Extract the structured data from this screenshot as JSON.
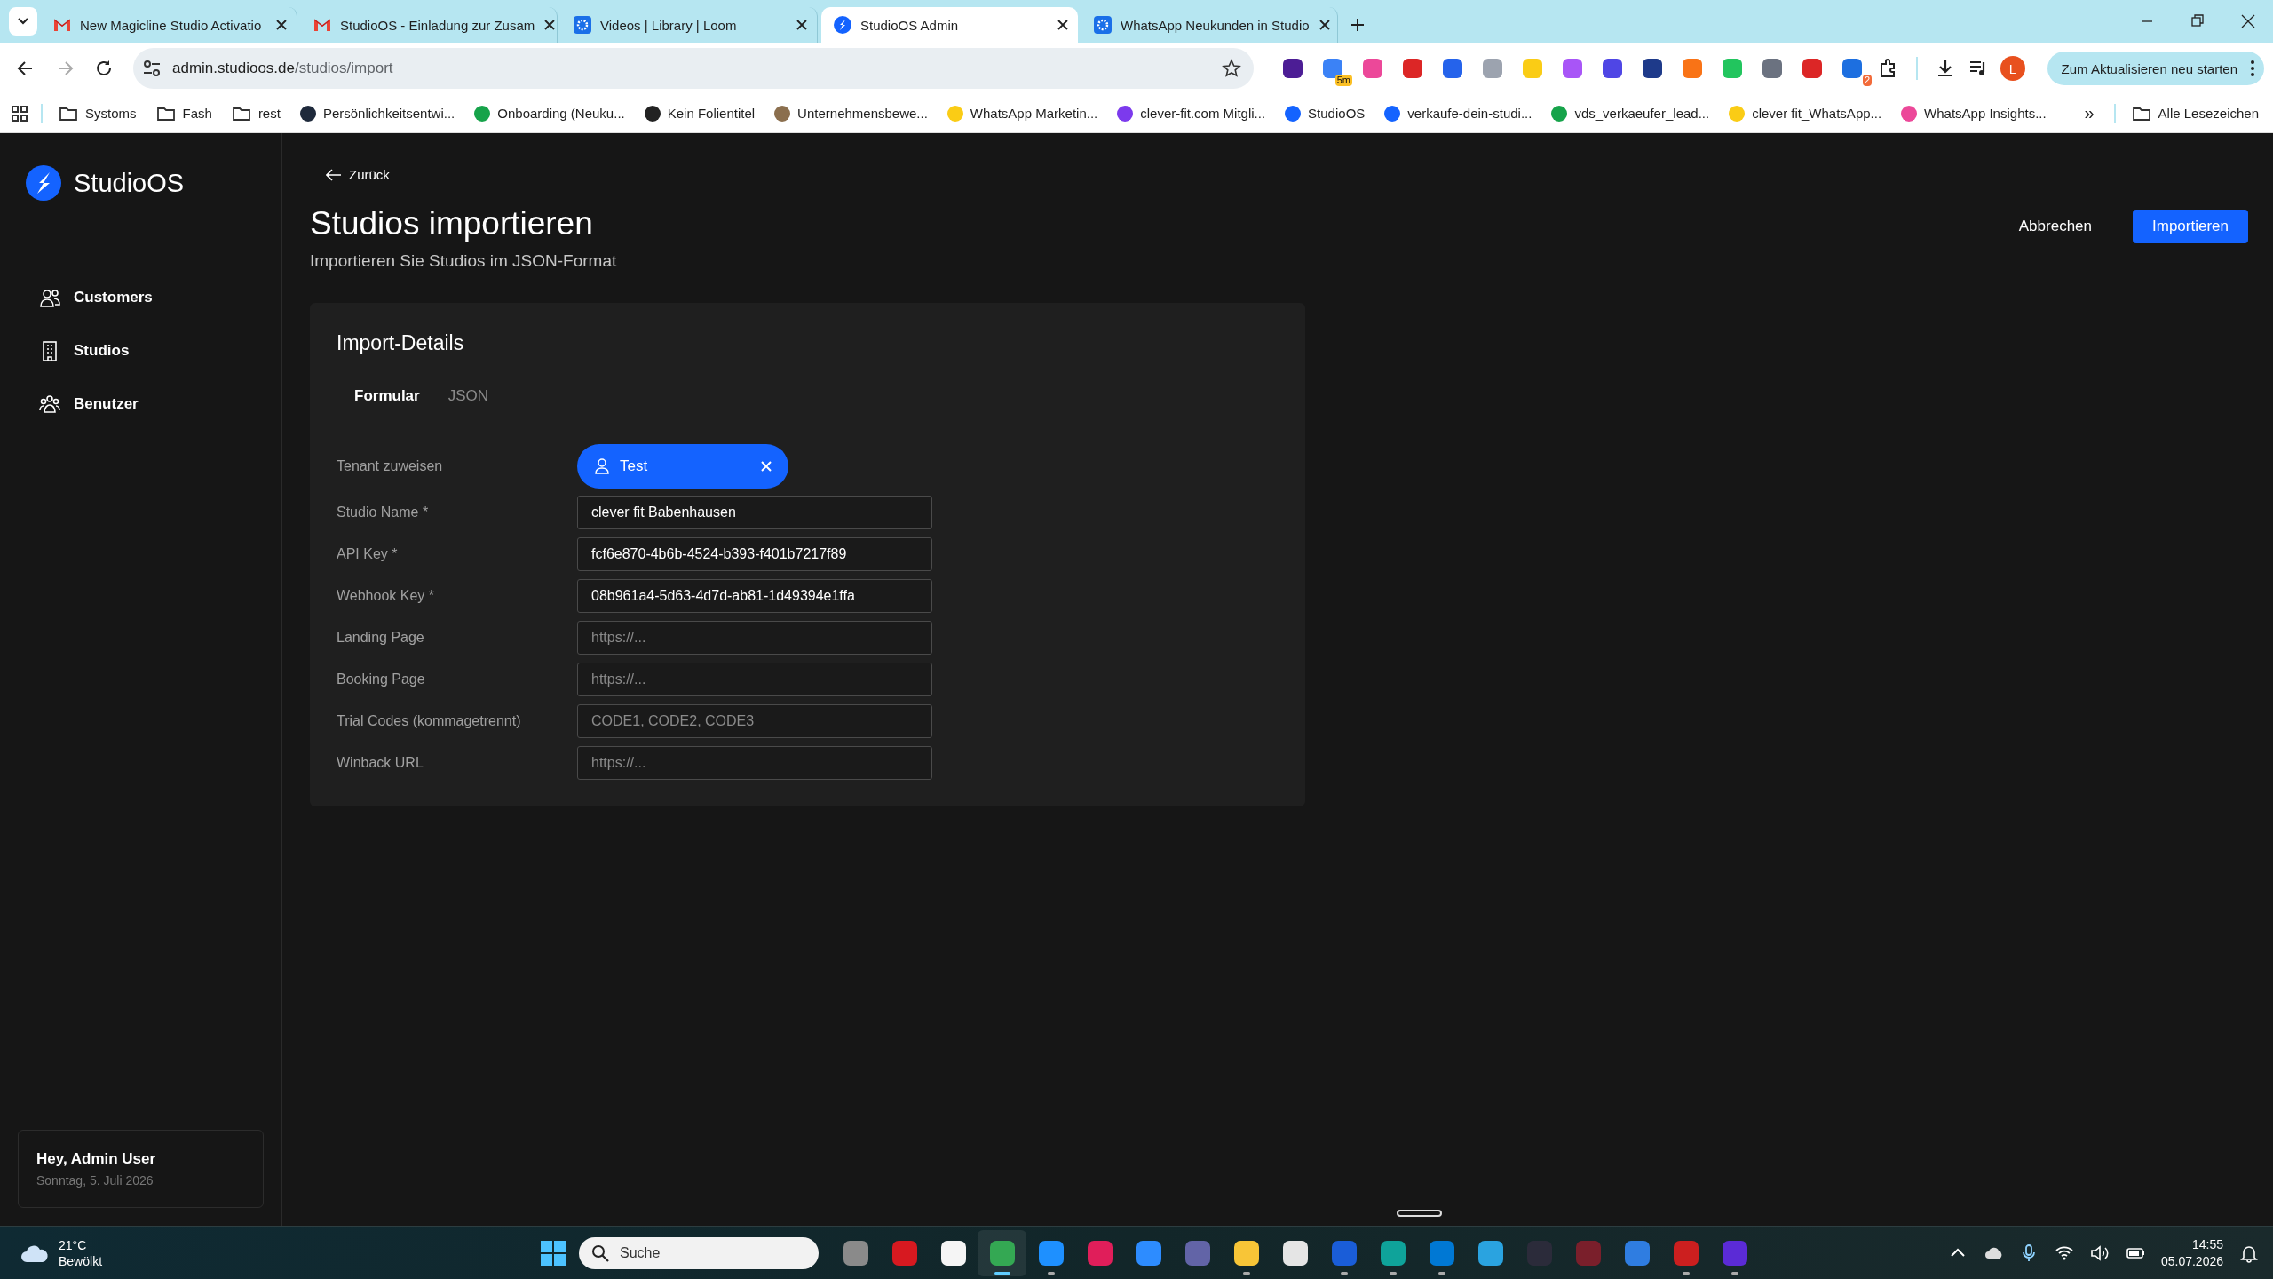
{
  "browser": {
    "tabs": [
      {
        "title": "New Magicline Studio Activatio",
        "kind": "mail",
        "selected": false
      },
      {
        "title": "StudioOS - Einladung zur Zusam",
        "kind": "mail",
        "selected": false
      },
      {
        "title": "Videos | Library | Loom",
        "kind": "gear",
        "selected": false
      },
      {
        "title": "StudioOS Admin",
        "kind": "compass",
        "selected": true
      },
      {
        "title": "WhatsApp Neukunden in Studio",
        "kind": "gear",
        "selected": false
      }
    ],
    "address": {
      "host": "admin.studioos.de",
      "path": "/studios/import"
    },
    "extensions": [
      {
        "color": "#4c1d95"
      },
      {
        "color": "#3b82f6",
        "badge": "5m"
      },
      {
        "color": "#ec4899"
      },
      {
        "color": "#dc2626"
      },
      {
        "color": "#2563eb"
      },
      {
        "color": "#9ca3af"
      },
      {
        "color": "#facc15"
      },
      {
        "color": "#a855f7"
      },
      {
        "color": "#4f46e5"
      },
      {
        "color": "#1e3a8a"
      },
      {
        "color": "#f97316"
      },
      {
        "color": "#22c55e"
      },
      {
        "color": "#6b7280"
      },
      {
        "color": "#dc2626"
      },
      {
        "color": "#1d6fe0",
        "badge": "2"
      }
    ],
    "profile": "L",
    "update_button": "Zum Aktualisieren neu starten",
    "bookmarks": [
      {
        "label": "Systoms",
        "kind": "folder"
      },
      {
        "label": "Fash",
        "kind": "folder"
      },
      {
        "label": "rest",
        "kind": "folder"
      },
      {
        "label": "Persönlichkeitsentwi...",
        "kind": "site",
        "color": "#1e293b"
      },
      {
        "label": "Onboarding (Neuku...",
        "kind": "site",
        "color": "#16a34a"
      },
      {
        "label": "Kein Folientitel",
        "kind": "site",
        "color": "#222222"
      },
      {
        "label": "Unternehmensbewe...",
        "kind": "site",
        "color": "#8b6f4e"
      },
      {
        "label": "WhatsApp Marketin...",
        "kind": "site",
        "color": "#facc15"
      },
      {
        "label": "clever-fit.com Mitgli...",
        "kind": "site",
        "color": "#7c3aed"
      },
      {
        "label": "StudioOS",
        "kind": "site",
        "color": "#1463ff"
      },
      {
        "label": "verkaufe-dein-studi...",
        "kind": "site",
        "color": "#1463ff"
      },
      {
        "label": "vds_verkaeufer_lead...",
        "kind": "site",
        "color": "#16a34a"
      },
      {
        "label": "clever fit_WhatsApp...",
        "kind": "site",
        "color": "#facc15"
      },
      {
        "label": "WhatsApp Insights...",
        "kind": "site",
        "color": "#ec4899"
      }
    ],
    "more_bookmarks": "»",
    "all_bookmarks": "Alle Lesezeichen"
  },
  "app": {
    "brand": "StudioOS",
    "nav": [
      {
        "label": "Customers",
        "kind": "users"
      },
      {
        "label": "Studios",
        "kind": "building"
      },
      {
        "label": "Benutzer",
        "kind": "group"
      }
    ],
    "user": {
      "greeting": "Hey, Admin User",
      "date": "Sonntag, 5. Juli 2026"
    },
    "back": "Zurück",
    "title": "Studios importieren",
    "subtitle": "Importieren Sie Studios im JSON-Format",
    "actions": [
      {
        "label": "Abbrechen",
        "kind": "secondary"
      },
      {
        "label": "Importieren",
        "kind": "primary"
      }
    ],
    "card": {
      "title": "Import-Details",
      "tabs": [
        {
          "label": "Formular",
          "selected": true
        },
        {
          "label": "JSON",
          "selected": false
        }
      ],
      "fields": [
        {
          "kind": "tenant",
          "label": "Tenant zuweisen",
          "value": "Test"
        },
        {
          "kind": "input",
          "label": "Studio Name *",
          "value": "clever fit Babenhausen"
        },
        {
          "kind": "input",
          "label": "API Key *",
          "value": "fcf6e870-4b6b-4524-b393-f401b7217f89"
        },
        {
          "kind": "input",
          "label": "Webhook Key *",
          "value": "08b961a4-5d63-4d7d-ab81-1d49394e1ffa"
        },
        {
          "kind": "input",
          "label": "Landing Page",
          "placeholder": "https://..."
        },
        {
          "kind": "input",
          "label": "Booking Page",
          "placeholder": "https://..."
        },
        {
          "kind": "input",
          "label": "Trial Codes (kommagetrennt)",
          "placeholder": "CODE1, CODE2, CODE3"
        },
        {
          "kind": "input",
          "label": "Winback URL",
          "placeholder": "https://..."
        }
      ]
    }
  },
  "taskbar": {
    "weather": {
      "temp": "21°C",
      "condition": "Bewölkt"
    },
    "search": {
      "placeholder": "Suche"
    },
    "apps": [
      {
        "color": "#8a8a8a",
        "running": false,
        "selected": false
      },
      {
        "color": "#d71920",
        "running": false,
        "selected": false
      },
      {
        "color": "#f5f5f5",
        "running": false,
        "selected": false
      },
      {
        "color": "#34a853",
        "running": true,
        "selected": true
      },
      {
        "color": "#1e90ff",
        "running": true,
        "selected": false
      },
      {
        "color": "#e01e5a",
        "running": false,
        "selected": false
      },
      {
        "color": "#2d8cff",
        "running": false,
        "selected": false
      },
      {
        "color": "#6264a7",
        "running": false,
        "selected": false
      },
      {
        "color": "#f8c537",
        "running": true,
        "selected": false
      },
      {
        "color": "#e5e5e5",
        "running": false,
        "selected": false
      },
      {
        "color": "#1a5dd8",
        "running": true,
        "selected": false
      },
      {
        "color": "#0fa39a",
        "running": true,
        "selected": false
      },
      {
        "color": "#0078d4",
        "running": true,
        "selected": false
      },
      {
        "color": "#2aa3e0",
        "running": false,
        "selected": false
      },
      {
        "color": "#2b2b3a",
        "running": false,
        "selected": false
      },
      {
        "color": "#7a1f2b",
        "running": false,
        "selected": false
      },
      {
        "color": "#2f7de1",
        "running": false,
        "selected": false
      },
      {
        "color": "#cc1f1f",
        "running": true,
        "selected": false
      },
      {
        "color": "#5b2bd6",
        "running": true,
        "selected": false
      }
    ],
    "time": "14:55",
    "date": "05.07.2026"
  }
}
